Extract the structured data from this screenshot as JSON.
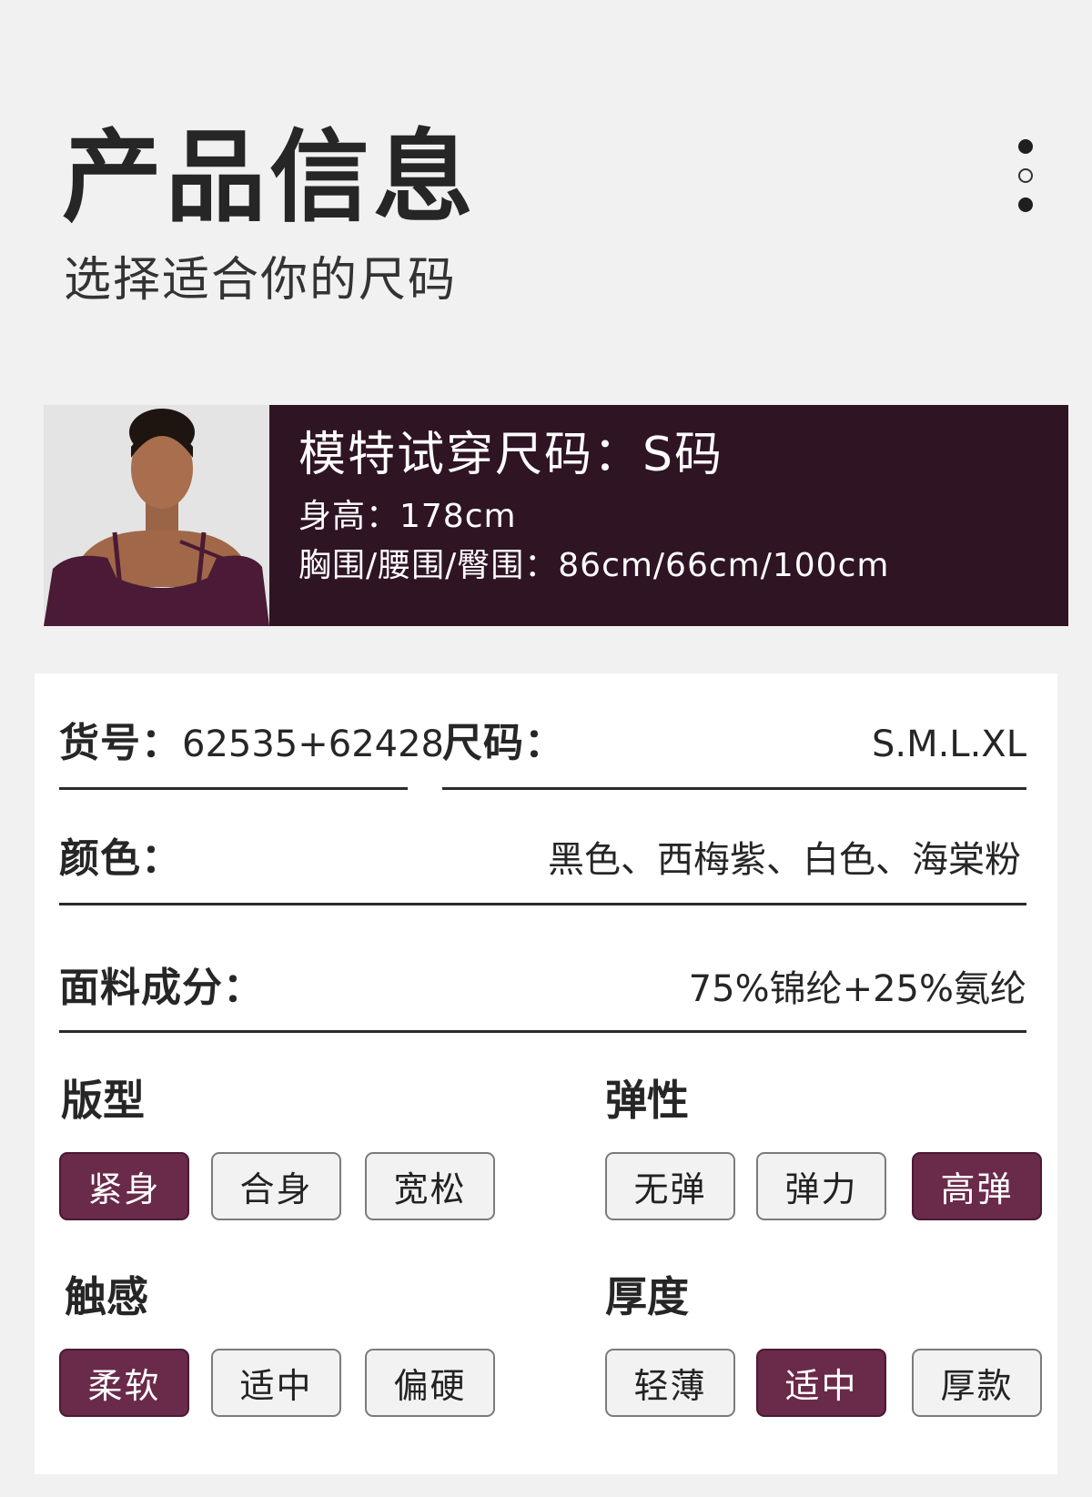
{
  "header": {
    "title": "产品信息",
    "subtitle": "选择适合你的尺码"
  },
  "banner": {
    "model_size": "模特试穿尺码：S码",
    "height": "身高：178cm",
    "measurements": "胸围/腰围/臀围：86cm/66cm/100cm",
    "accent_color": "#2f1424"
  },
  "specs": {
    "item_no_label": "货号：",
    "item_no_value": "62535+62428",
    "size_label": "尺码：",
    "size_value": "S.M.L.XL",
    "color_label": "颜色：",
    "color_value": "黑色、西梅紫、白色、海棠粉",
    "fabric_label": "面料成分：",
    "fabric_value": "75%锦纶+25%氨纶"
  },
  "attributes": {
    "fit": {
      "title": "版型",
      "options": [
        "紧身",
        "合身",
        "宽松"
      ],
      "selected": "紧身"
    },
    "elasticity": {
      "title": "弹性",
      "options": [
        "无弹",
        "弹力",
        "高弹"
      ],
      "selected": "高弹"
    },
    "touch": {
      "title": "触感",
      "options": [
        "柔软",
        "适中",
        "偏硬"
      ],
      "selected": "柔软"
    },
    "thickness": {
      "title": "厚度",
      "options": [
        "轻薄",
        "适中",
        "厚款"
      ],
      "selected": "适中"
    },
    "selected_color": "#6a2a4a"
  }
}
